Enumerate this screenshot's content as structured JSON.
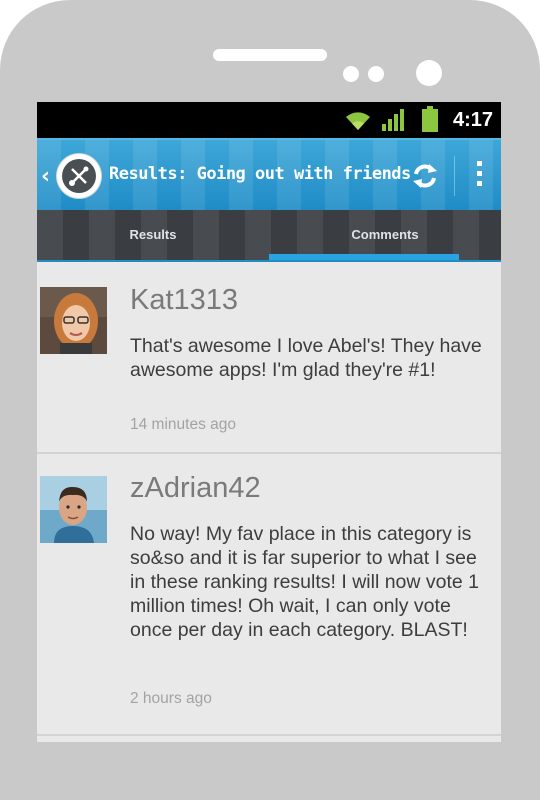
{
  "status_bar": {
    "clock": "4:17",
    "icons": [
      "wifi-icon",
      "signal-icon",
      "battery-icon"
    ],
    "accent": "#8dc63f"
  },
  "action_bar": {
    "title": "Results: Going out with friends",
    "icons": [
      "back-icon",
      "app-logo-icon",
      "refresh-icon",
      "overflow-menu-icon"
    ],
    "color": "#2596cf"
  },
  "tabs": [
    {
      "label": "Results",
      "selected": false
    },
    {
      "label": "Comments",
      "selected": true
    }
  ],
  "comments": [
    {
      "username": "Kat1313",
      "text": "That's awesome I love Abel's! They have awesome apps! I'm glad they're #1!",
      "time": "14 minutes ago"
    },
    {
      "username": "zAdrian42",
      "text": "No way! My fav place in this category is so&so and it is far superior to what I see in these ranking results! I will now vote 1 million times! Oh wait, I can only vote once per day in each category. BLAST!",
      "time": "2 hours ago"
    }
  ]
}
